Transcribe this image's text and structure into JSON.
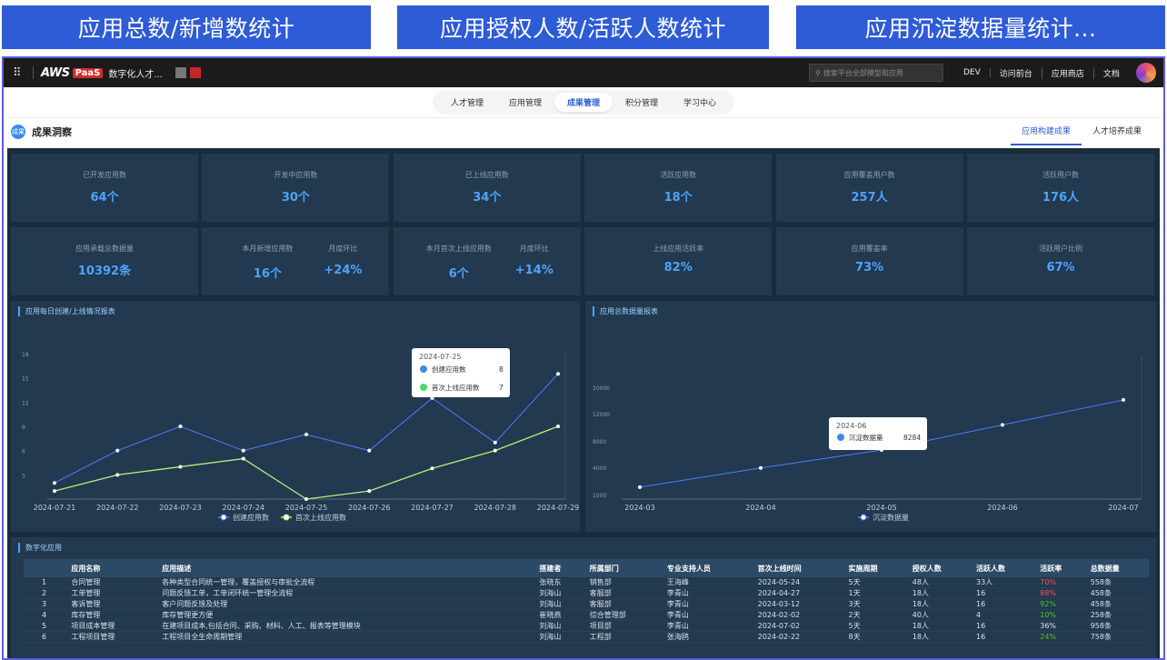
{
  "banners": [
    "应用总数/新增数统计",
    "应用授权人数/活跃人数统计",
    "应用沉淀数据量统计..."
  ],
  "topbar": {
    "logo": "AWS",
    "paas": "PaaS",
    "app_name": "数字化人才...",
    "search_placeholder": "搜索平台全部模型和应用",
    "links": [
      "DEV",
      "访问前台",
      "应用商店",
      "文档"
    ]
  },
  "nav": {
    "tabs": [
      "人才管理",
      "应用管理",
      "成果管理",
      "积分管理",
      "学习中心"
    ],
    "active": 2
  },
  "subheader": {
    "icon_text": "成果",
    "title": "成果洞察",
    "tabs": [
      "应用构建成果",
      "人才培养成果"
    ],
    "active": 0
  },
  "cards_row1": [
    {
      "label": "已开发应用数",
      "value": "64个"
    },
    {
      "label": "开发中应用数",
      "value": "30个"
    },
    {
      "label": "已上线应用数",
      "value": "34个"
    },
    {
      "label": "活跃应用数",
      "value": "18个"
    },
    {
      "label": "应用覆盖用户数",
      "value": "257人"
    },
    {
      "label": "活跃用户数",
      "value": "176人"
    }
  ],
  "cards_row2": [
    {
      "type": "single",
      "label": "应用承载总数据量",
      "value": "10392条"
    },
    {
      "type": "double",
      "label": "本月新增应用数",
      "value": "16个",
      "label2": "月度环比",
      "value2": "+24%"
    },
    {
      "type": "double",
      "label": "本月首次上线应用数",
      "value": "6个",
      "label2": "月度环比",
      "value2": "+14%"
    },
    {
      "type": "single",
      "label": "上线应用活跃率",
      "value": "82%"
    },
    {
      "type": "single",
      "label": "应用覆盖率",
      "value": "73%"
    },
    {
      "type": "single",
      "label": "活跃用户比例",
      "value": "67%"
    }
  ],
  "left_chart_title": "应用每日创建/上线情况报表",
  "right_chart_title": "应用总数据量报表",
  "left_tooltip": {
    "date": "2024-07-25",
    "rows": [
      {
        "name": "创建应用数",
        "value": "8"
      },
      {
        "name": "首次上线应用数",
        "value": "7"
      }
    ]
  },
  "right_tooltip": {
    "date": "2024-06",
    "rows": [
      {
        "name": "沉淀数据量",
        "value": "8284"
      }
    ]
  },
  "table_title": "数字化应用",
  "table": {
    "headers": [
      "",
      "应用名称",
      "应用描述",
      "搭建者",
      "所属部门",
      "专业支持人员",
      "首次上线时间",
      "实施周期",
      "授权人数",
      "活跃人数",
      "活跃率",
      "总数据量"
    ],
    "rows": [
      [
        "1",
        "合同管理",
        "各种类型合同统一管理，覆盖授权与审批全流程",
        "张晓东",
        "销售部",
        "王海峰",
        "2024-05-24",
        "5天",
        "48人",
        "33人",
        "70%",
        "558条"
      ],
      [
        "2",
        "工单管理",
        "问题反馈工单，工单闭环统一管理全流程",
        "刘海山",
        "客服部",
        "李青山",
        "2024-04-27",
        "1天",
        "18人",
        "16",
        "88%",
        "458条"
      ],
      [
        "3",
        "客诉管理",
        "客户问题反馈及处理",
        "刘海山",
        "客服部",
        "李青山",
        "2024-03-12",
        "3天",
        "18人",
        "16",
        "92%",
        "458条"
      ],
      [
        "4",
        "库存管理",
        "库存管理更方便",
        "崔晓燕",
        "综合管理部",
        "李青山",
        "2024-02-02",
        "2天",
        "40人",
        "4",
        "10%",
        "258条"
      ],
      [
        "5",
        "项目成本管理",
        "在建项目成本,包括合同、采购、材料、人工、报表等管理模块",
        "刘海山",
        "项目部",
        "李青山",
        "2024-07-02",
        "5天",
        "18人",
        "16",
        "36%",
        "958条"
      ],
      [
        "6",
        "工程项目管理",
        "工程项目全生命周期管理",
        "刘海山",
        "工程部",
        "张海鸥",
        "2024-02-22",
        "8天",
        "18人",
        "16",
        "24%",
        "758条"
      ]
    ],
    "rate_colors": [
      "#ff4d4f",
      "#ff4d4f",
      "#52c41a",
      "#52c41a",
      "#d8e2ec",
      "#52c41a"
    ]
  },
  "chart_data": [
    {
      "type": "line",
      "title": "应用每日创建/上线情况报表",
      "x": [
        "2024-07-21",
        "2024-07-22",
        "2024-07-23",
        "2024-07-24",
        "2024-07-25",
        "2024-07-26",
        "2024-07-27",
        "2024-07-28",
        "2024-07-29"
      ],
      "ylim": [
        0,
        18
      ],
      "yticks": [
        3,
        6,
        9,
        12,
        15,
        18
      ],
      "series": [
        {
          "name": "创建应用数",
          "color": "#4f7cff",
          "values": [
            2,
            6,
            9,
            6,
            8,
            6,
            12.5,
            7,
            15.5
          ]
        },
        {
          "name": "首次上线应用数",
          "color": "#b8f07a",
          "values": [
            1,
            3,
            4,
            5,
            0,
            1,
            3.8,
            6,
            9
          ]
        }
      ],
      "legend": "bottom"
    },
    {
      "type": "line",
      "title": "应用总数据量报表",
      "x": [
        "2024-03",
        "2024-04",
        "2024-05",
        "2024-06",
        "2024-07"
      ],
      "ylim": [
        0,
        12000
      ],
      "yticks": [
        1000,
        4000,
        8000,
        12000,
        16000
      ],
      "ytick_labels": [
        "1000",
        "4000",
        "8000",
        "12000",
        "10000"
      ],
      "series": [
        {
          "name": "沉淀数据量",
          "color": "#4f7cff",
          "values": [
            1000,
            2600,
            4100,
            6200,
            8284
          ]
        }
      ],
      "legend": "bottom"
    }
  ]
}
